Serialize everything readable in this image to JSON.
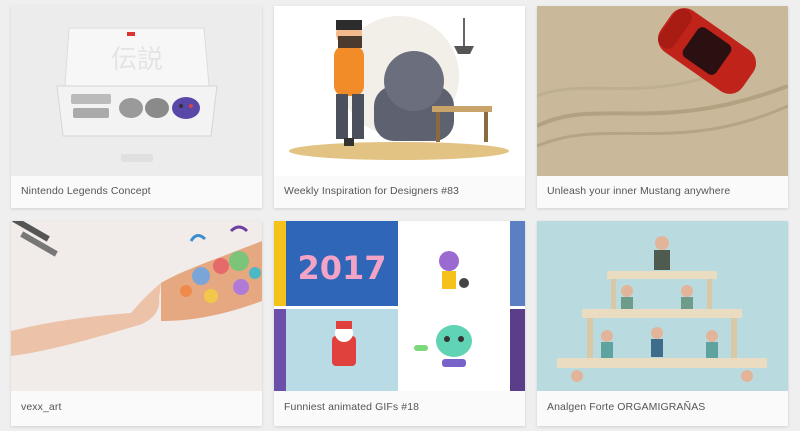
{
  "cards": [
    {
      "title": "Nintendo Legends Concept"
    },
    {
      "title": "Weekly Inspiration for Designers #83"
    },
    {
      "title": "Unleash your inner Mustang anywhere"
    },
    {
      "title": "vexx_art"
    },
    {
      "title": "Funniest animated GIFs #18"
    },
    {
      "title": "Analgen Forte ORGAMIGRAÑAS"
    }
  ],
  "thumbs": {
    "nintendo_box_kanji": "伝説",
    "gif_year": "2017"
  },
  "colors": {
    "page_background": "#efefef",
    "card_background": "#fafafa",
    "caption_text": "#555555"
  }
}
